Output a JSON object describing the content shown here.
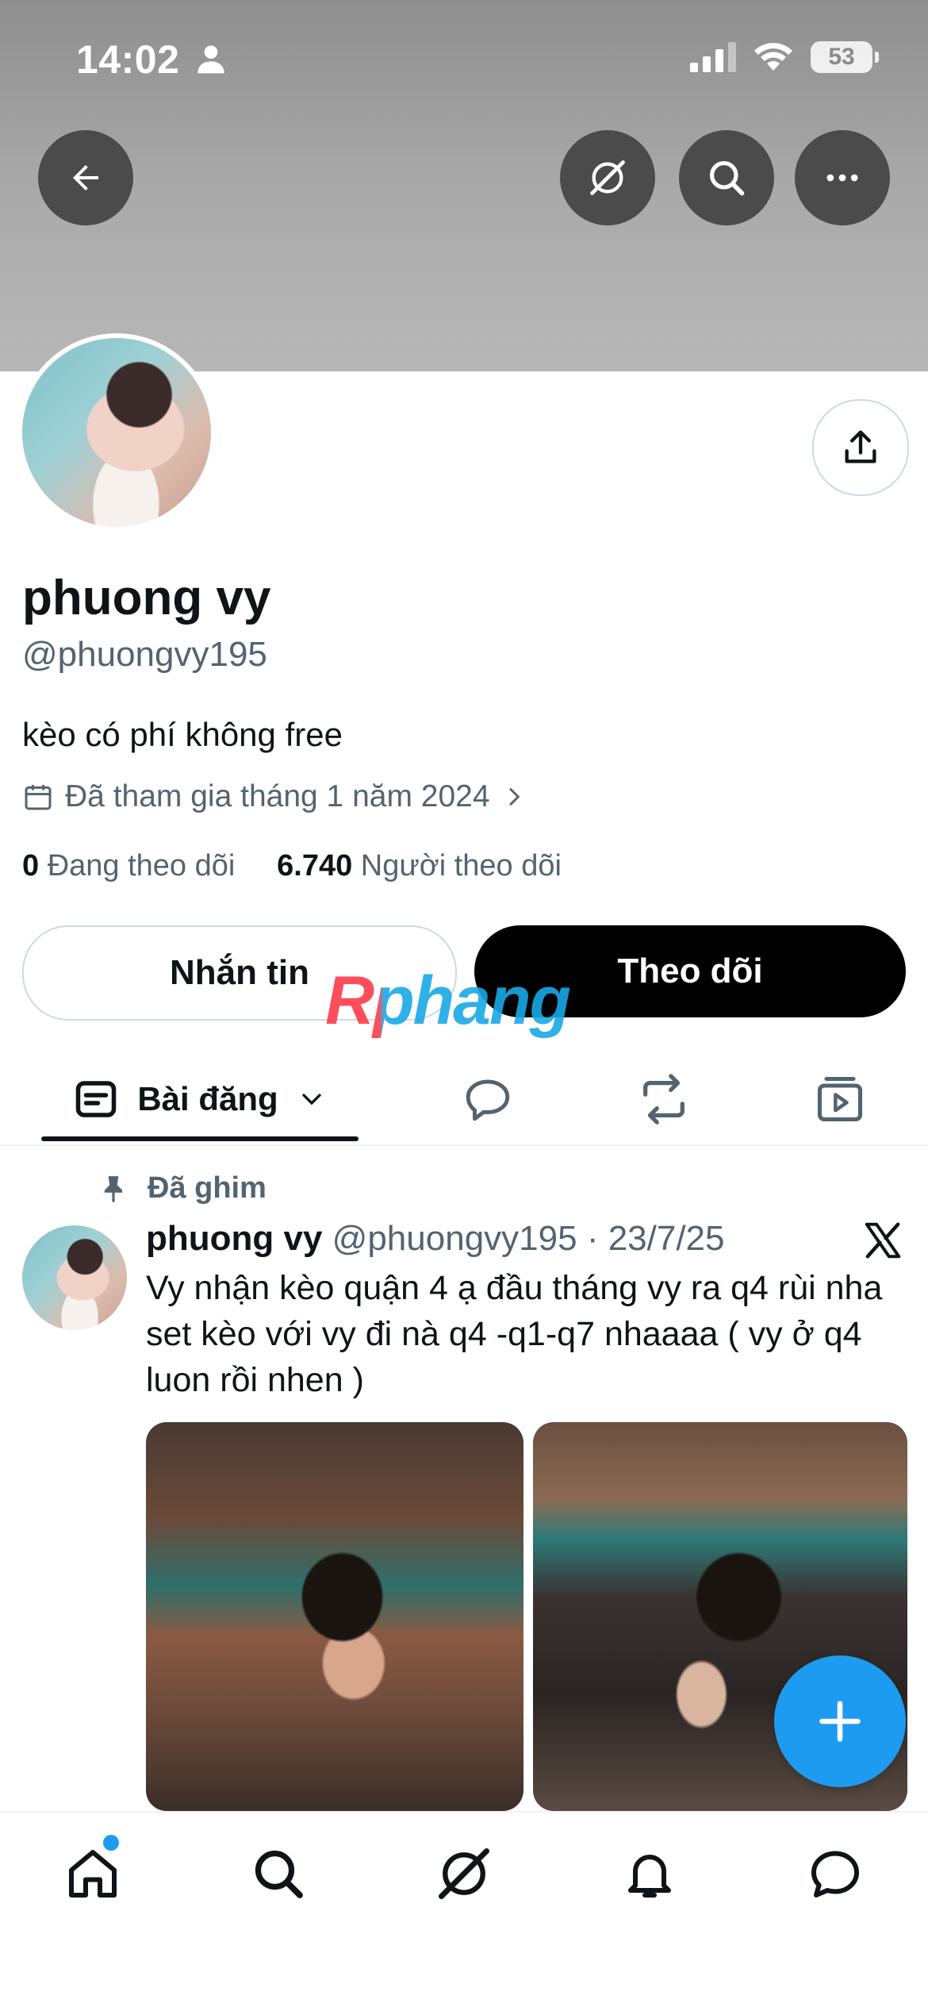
{
  "status_bar": {
    "time": "14:02",
    "battery": "53"
  },
  "profile": {
    "name": "phuong vy",
    "handle": "@phuongvy195",
    "bio": "kèo có phí không free",
    "joined": "Đã tham gia tháng 1 năm 2024",
    "following_count": "0",
    "following_label": "Đang theo dõi",
    "followers_count": "6.740",
    "followers_label": "Người theo dõi"
  },
  "actions": {
    "message_label": "Nhắn tin",
    "follow_label": "Theo dõi"
  },
  "watermark": "Rphang",
  "tabs": {
    "posts_label": "Bài đăng"
  },
  "pinned_post": {
    "pinned_label": "Đã ghim",
    "author_name": "phuong vy",
    "author_handle": "@phuongvy195",
    "date": "· 23/7/25",
    "text": "Vy nhận kèo quận 4 ạ đầu tháng vy ra q4 rùi nha set kèo với vy đi nà q4 -q1-q7 nhaaaa ( vy ở q4 luon rồi nhen )"
  },
  "colors": {
    "accent": "#1d9bf0",
    "secondary_text": "#536471",
    "primary_text": "#0f1419"
  },
  "icons": [
    "back-arrow-icon",
    "grok-icon",
    "search-icon",
    "more-icon",
    "share-icon",
    "calendar-icon",
    "chevron-right-icon",
    "posts-icon",
    "chevron-down-icon",
    "reply-icon",
    "repost-icon",
    "media-icon",
    "pin-icon",
    "x-logo-icon",
    "plus-icon",
    "home-icon",
    "bell-icon",
    "messages-icon"
  ]
}
